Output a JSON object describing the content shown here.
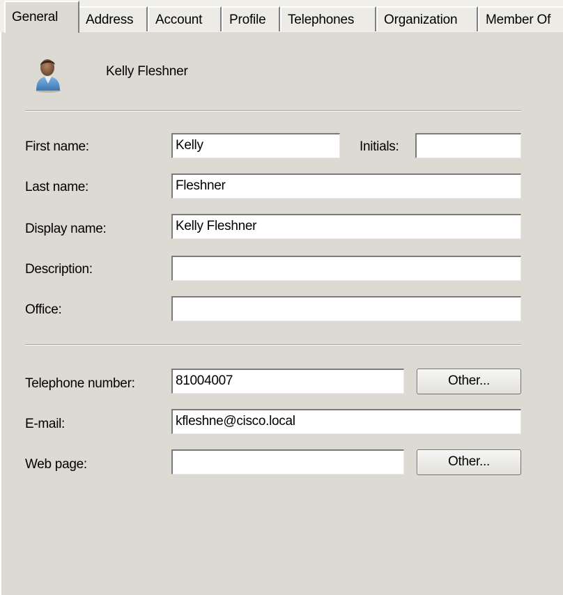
{
  "tabs": [
    {
      "label": "General",
      "active": true
    },
    {
      "label": "Address",
      "active": false
    },
    {
      "label": "Account",
      "active": false
    },
    {
      "label": "Profile",
      "active": false
    },
    {
      "label": "Telephones",
      "active": false
    },
    {
      "label": "Organization",
      "active": false
    },
    {
      "label": "Member Of",
      "active": false
    }
  ],
  "header": {
    "display_name": "Kelly Fleshner",
    "icon": "user-icon"
  },
  "fields": {
    "first_name": {
      "label": "First name:",
      "value": "Kelly"
    },
    "initials": {
      "label": "Initials:",
      "value": ""
    },
    "last_name": {
      "label": "Last name:",
      "value": "Fleshner"
    },
    "display_name": {
      "label": "Display name:",
      "value": "Kelly Fleshner"
    },
    "description": {
      "label": "Description:",
      "value": ""
    },
    "office": {
      "label": "Office:",
      "value": ""
    },
    "telephone": {
      "label": "Telephone number:",
      "value": "81004007",
      "other_label": "Other..."
    },
    "email": {
      "label": "E-mail:",
      "value": "kfleshne@cisco.local"
    },
    "web_page": {
      "label": "Web page:",
      "value": "",
      "other_label": "Other..."
    }
  },
  "colors": {
    "dialog_bg": "#dddad4",
    "field_bg": "#ffffff"
  }
}
